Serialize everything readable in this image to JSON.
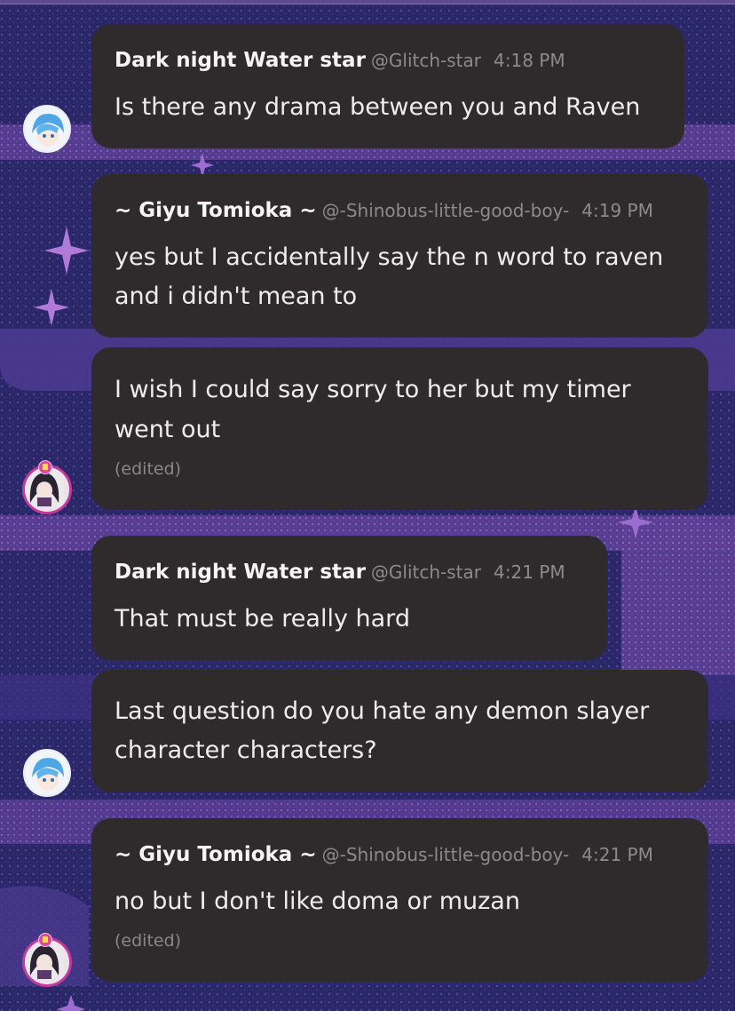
{
  "messages": [
    {
      "author": "Dark night Water star",
      "handle": "@Glitch-star",
      "time": "4:18 PM",
      "lines": [
        "Is there any drama between you and Raven"
      ],
      "edited": ""
    },
    {
      "author": "~ Giyu Tomioka ~",
      "handle": "@-Shinobus-little-good-boy-",
      "time": "4:19 PM",
      "lines": [
        "yes but I accidentally say the n word to raven",
        "and i didn't mean to"
      ],
      "edited": ""
    },
    {
      "author": "",
      "handle": "",
      "time": "",
      "lines": [
        "I wish I could say sorry to her  but my timer",
        "went out"
      ],
      "edited": "(edited)"
    },
    {
      "author": "Dark night Water star",
      "handle": "@Glitch-star",
      "time": "4:21 PM",
      "lines": [
        "That must be really hard"
      ],
      "edited": ""
    },
    {
      "author": "",
      "handle": "",
      "time": "",
      "lines": [
        "Last question do you hate any demon slayer",
        "character characters?"
      ],
      "edited": ""
    },
    {
      "author": "~ Giyu Tomioka ~",
      "handle": "@-Shinobus-little-good-boy-",
      "time": "4:21 PM",
      "lines": [
        "no but I don't like doma or muzan"
      ],
      "edited": "(edited)"
    }
  ],
  "avatars": [
    {
      "user": "Dark night Water star",
      "icon": "blue-hair-avatar"
    },
    {
      "user": "~ Giyu Tomioka ~",
      "icon": "dark-hair-avatar"
    }
  ],
  "colors": {
    "background": "#2e2a6b",
    "bubble": "#2f2b2c",
    "text": "#ededed",
    "meta": "#8e8a8c",
    "accent": "#b07ad8"
  }
}
